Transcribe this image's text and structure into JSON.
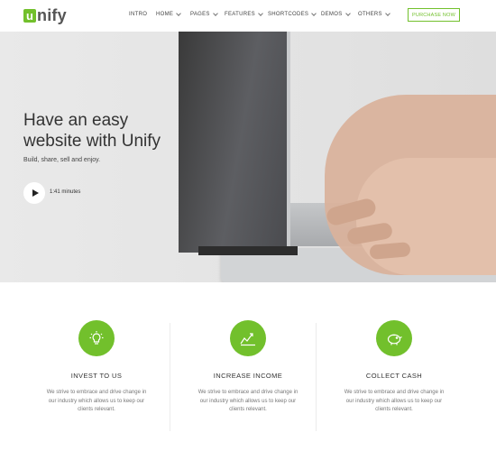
{
  "brand": {
    "logo_letter": "u",
    "logo_rest": "nify",
    "accent": "#72c02c"
  },
  "nav": {
    "items": [
      {
        "label": "INTRO",
        "has_caret": false
      },
      {
        "label": "HOME",
        "has_caret": true
      },
      {
        "label": "PAGES",
        "has_caret": true
      },
      {
        "label": "FEATURES",
        "has_caret": true
      },
      {
        "label": "SHORTCODES",
        "has_caret": true
      },
      {
        "label": "DEMOS",
        "has_caret": true
      },
      {
        "label": "OTHERS",
        "has_caret": true
      }
    ],
    "purchase_label": "PURCHASE NOW"
  },
  "hero": {
    "title_line1": "Have an easy",
    "title_line2": "website with Unify",
    "subtitle": "Build, share, sell and enjoy.",
    "duration": "1:41 minutes"
  },
  "features": [
    {
      "icon": "lightbulb-icon",
      "title": "INVEST TO US",
      "desc": "We strive to embrace and drive change in our industry which allows us to keep our clients relevant."
    },
    {
      "icon": "chart-growth-icon",
      "title": "INCREASE INCOME",
      "desc": "We strive to embrace and drive change in our industry which allows us to keep our clients relevant."
    },
    {
      "icon": "piggy-bank-icon",
      "title": "COLLECT CASH",
      "desc": "We strive to embrace and drive change in our industry which allows us to keep our clients relevant."
    }
  ]
}
